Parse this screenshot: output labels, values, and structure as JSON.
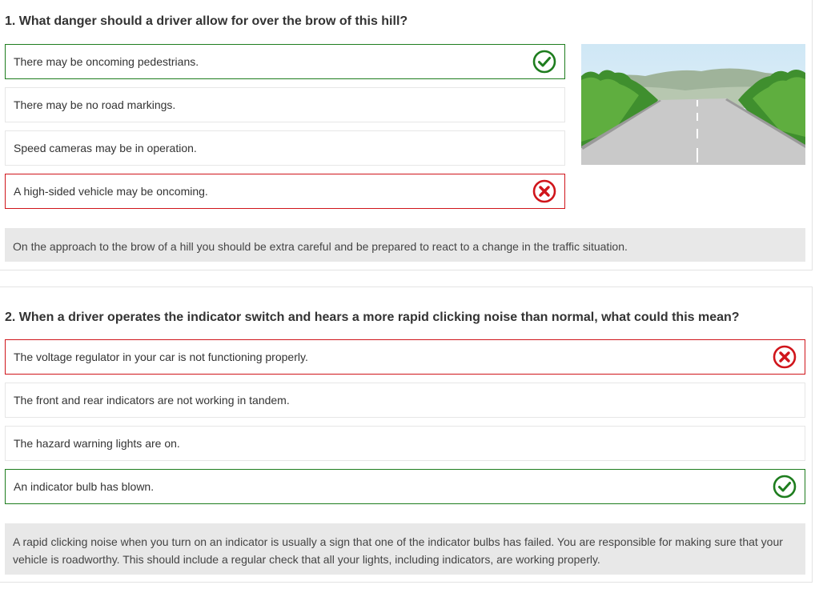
{
  "questions": [
    {
      "title": "1. What danger should a driver allow for over the brow of this hill?",
      "answers": [
        {
          "text": "There may be oncoming pedestrians.",
          "state": "correct"
        },
        {
          "text": "There may be no road markings.",
          "state": "none"
        },
        {
          "text": "Speed cameras may be in operation.",
          "state": "none"
        },
        {
          "text": "A high-sided vehicle may be oncoming.",
          "state": "wrong"
        }
      ],
      "explanation": "On the approach to the brow of a hill you should be extra careful and be prepared to react to a change in the traffic situation."
    },
    {
      "title": "2. When a driver operates the indicator switch and hears a more rapid clicking noise than normal, what could this mean?",
      "answers": [
        {
          "text": "The voltage regulator in your car is not functioning properly.",
          "state": "wrong"
        },
        {
          "text": "The front and rear indicators are not working in tandem.",
          "state": "none"
        },
        {
          "text": "The hazard warning lights are on.",
          "state": "none"
        },
        {
          "text": "An indicator bulb has blown.",
          "state": "correct"
        }
      ],
      "explanation": "A rapid clicking noise when you turn on an indicator is usually a sign that one of the indicator bulbs has failed. You are responsible for making sure that your vehicle is roadworthy. This should include a regular check that all your lights, including indicators, are working properly."
    }
  ],
  "colors": {
    "correct": "#1e7d1e",
    "wrong": "#d0151b",
    "explanation_bg": "#e8e8e8"
  },
  "icons": {
    "correct": "check-circle-icon",
    "wrong": "x-circle-icon"
  }
}
